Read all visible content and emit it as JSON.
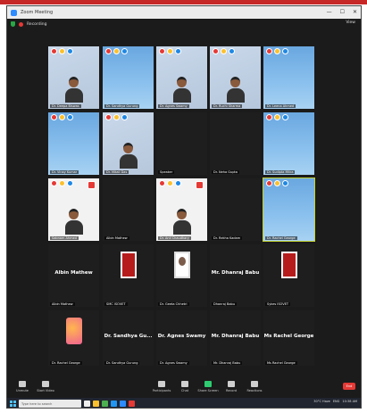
{
  "window": {
    "title": "Zoom Meeting",
    "controls": [
      "—",
      "☐",
      "✕"
    ]
  },
  "topbar": {
    "recording_label": "Recording",
    "view_label": "View"
  },
  "tiles": [
    {
      "kind": "video",
      "caption": "Dr. Deepa Biswas"
    },
    {
      "kind": "poster",
      "caption": "Dr. Sandhya Gurung"
    },
    {
      "kind": "video",
      "caption": "Dr. Agnes Swamy"
    },
    {
      "kind": "video",
      "caption": "Dr. Ruchi Sharma"
    },
    {
      "kind": "poster",
      "caption": "Dr. Leena Ahmed"
    },
    {
      "kind": "poster",
      "caption": "Dr. Vinay Kumar"
    },
    {
      "kind": "video",
      "caption": "Dr. Mitali Das"
    },
    {
      "kind": "dark",
      "caption": "Speaker"
    },
    {
      "kind": "dark",
      "caption": "Dr. Neha Gupta"
    },
    {
      "kind": "poster",
      "caption": "Dr. Sudipta Mitra"
    },
    {
      "kind": "white",
      "caption": "Sabnam Ahmed"
    },
    {
      "kind": "dark",
      "caption": "Albin Mathew"
    },
    {
      "kind": "white",
      "caption": "Dr. Anil Chaudhary"
    },
    {
      "kind": "dark",
      "caption": "Dr. Rekha Kadam"
    },
    {
      "kind": "poster",
      "caption": "Dr. Rachel George"
    },
    {
      "kind": "dark",
      "bigname": "Albin Mathew",
      "caption": "Albin Mathew"
    },
    {
      "kind": "dark",
      "avatar": "red",
      "caption": "SMC ISOVET"
    },
    {
      "kind": "dark",
      "avatar": "doc",
      "caption": "Dr. Geeta Chhetri"
    },
    {
      "kind": "dark",
      "bigname": "Mr. Dhanraj Babu",
      "caption": "Dhanraj Babu"
    },
    {
      "kind": "dark",
      "avatar": "red",
      "caption": "Sykes ISOVET"
    },
    {
      "kind": "dark",
      "avatar": "orange",
      "caption": "Dr. Rachel George"
    },
    {
      "kind": "dark",
      "bigname": "Dr. Sandhya Gu...",
      "caption": "Dr. Sandhya Gurung"
    },
    {
      "kind": "dark",
      "bigname": "Dr. Agnes Swamy",
      "caption": "Dr. Agnes Swamy"
    },
    {
      "kind": "dark",
      "bigname": "Mr. Dhanraj Babu",
      "caption": "Mr. Dhanraj Babu"
    },
    {
      "kind": "dark",
      "bigname": "Ms Rachel George",
      "caption": "Ms Rachel George"
    }
  ],
  "toolbar": {
    "items": [
      {
        "icon": "mic-icon",
        "label": "Unmute"
      },
      {
        "icon": "video-icon",
        "label": "Start Video"
      },
      {
        "icon": "participants-icon",
        "label": "Participants"
      },
      {
        "icon": "chat-icon",
        "label": "Chat"
      },
      {
        "icon": "share-screen-icon",
        "label": "Share Screen"
      },
      {
        "icon": "record-icon",
        "label": "Record"
      },
      {
        "icon": "reactions-icon",
        "label": "Reactions"
      }
    ],
    "participant_count": "95",
    "end_label": "End"
  },
  "taskbar": {
    "search_placeholder": "Type here to search",
    "weather": "30°C Haze",
    "language": "ENG",
    "time": "10:38 AM",
    "date": "25-06-2022"
  }
}
